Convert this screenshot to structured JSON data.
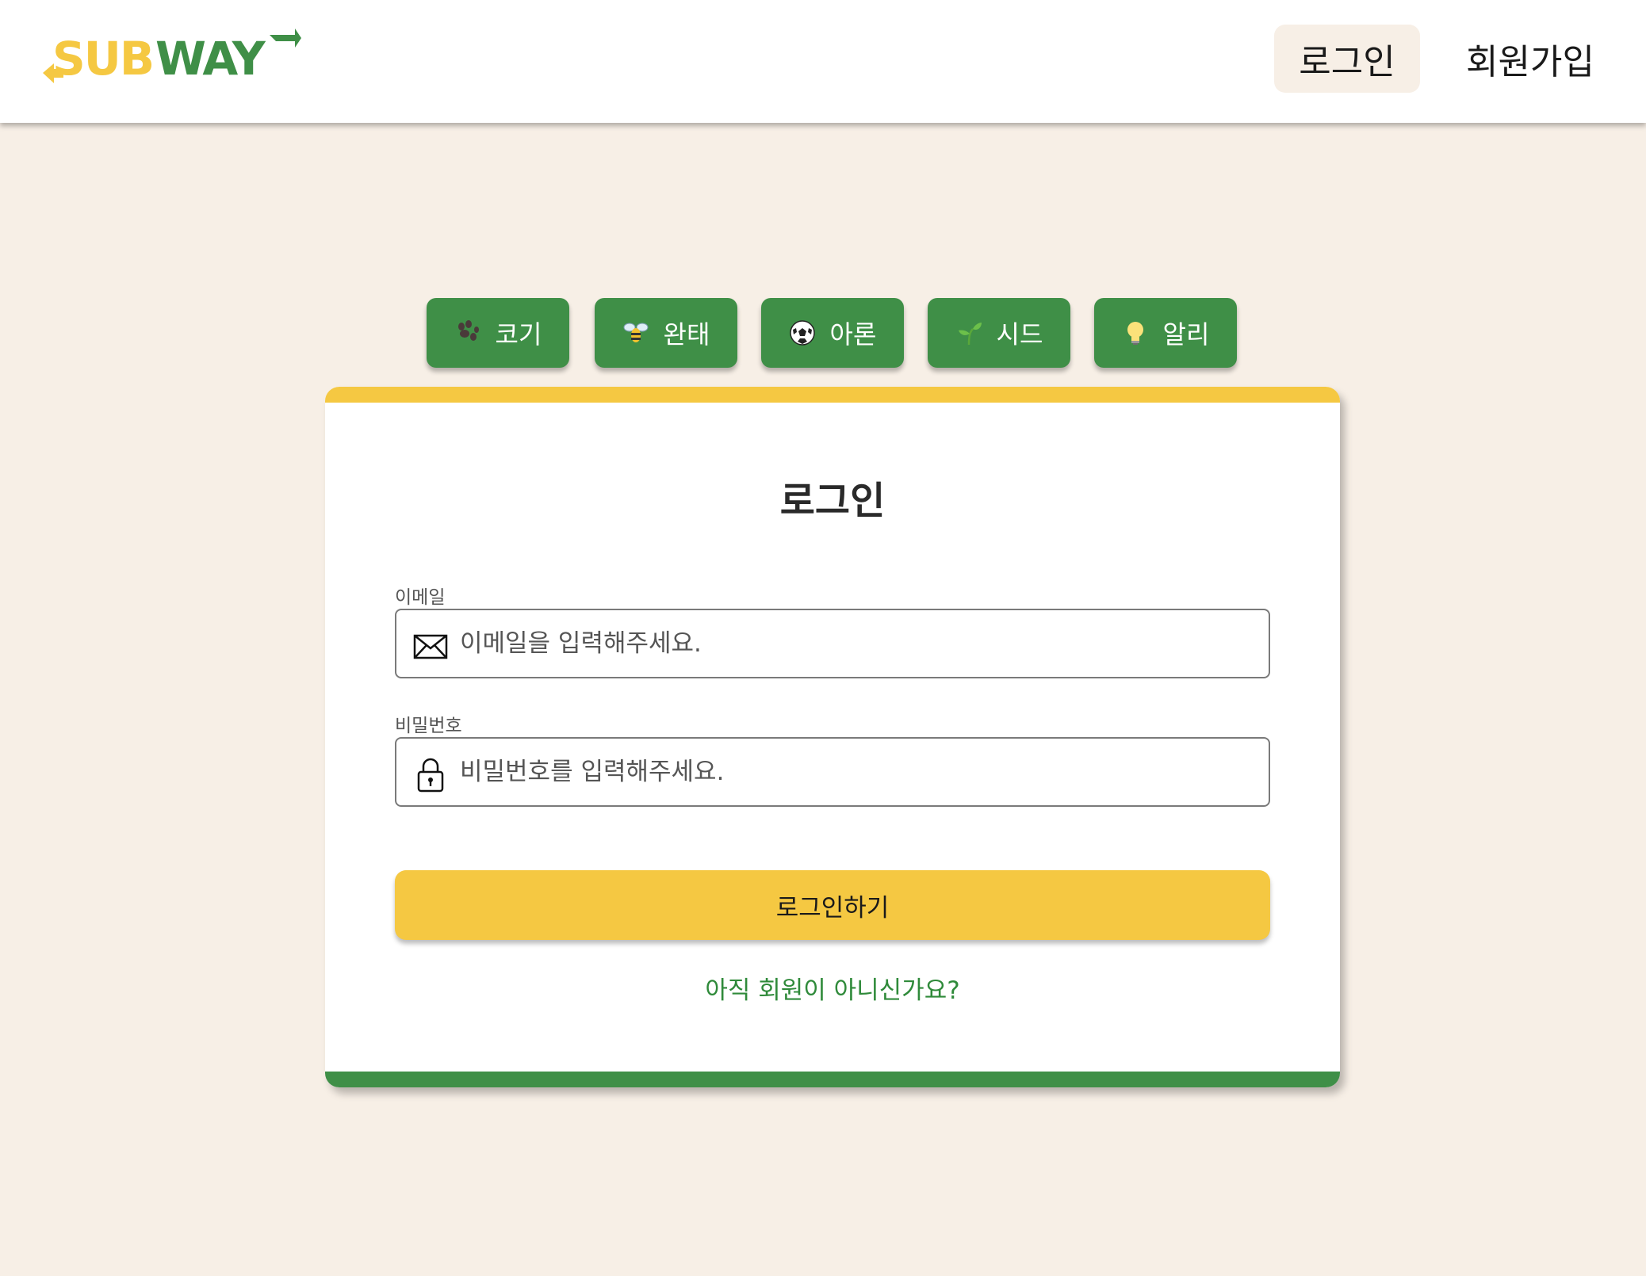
{
  "header": {
    "logo_text": "SUBWAY",
    "nav": [
      {
        "label": "로그인",
        "active": true
      },
      {
        "label": "회원가입",
        "active": false
      }
    ]
  },
  "quick_accounts": [
    {
      "icon": "paw-icon",
      "label": "코기"
    },
    {
      "icon": "bee-icon",
      "label": "완태"
    },
    {
      "icon": "soccer-ball-icon",
      "label": "아론"
    },
    {
      "icon": "seedling-icon",
      "label": "시드"
    },
    {
      "icon": "light-bulb-icon",
      "label": "알리"
    }
  ],
  "login_form": {
    "title": "로그인",
    "email": {
      "label": "이메일",
      "placeholder": "이메일을 입력해주세요.",
      "value": "",
      "icon": "envelope-icon"
    },
    "password": {
      "label": "비밀번호",
      "placeholder": "비밀번호를 입력해주세요.",
      "value": "",
      "icon": "lock-icon"
    },
    "submit_label": "로그인하기",
    "signup_prompt": "아직 회원이 아니신가요?"
  },
  "colors": {
    "background": "#f7efe6",
    "brand_green": "#3f8f47",
    "brand_yellow": "#f5c842",
    "link_green": "#2f8a3a"
  }
}
